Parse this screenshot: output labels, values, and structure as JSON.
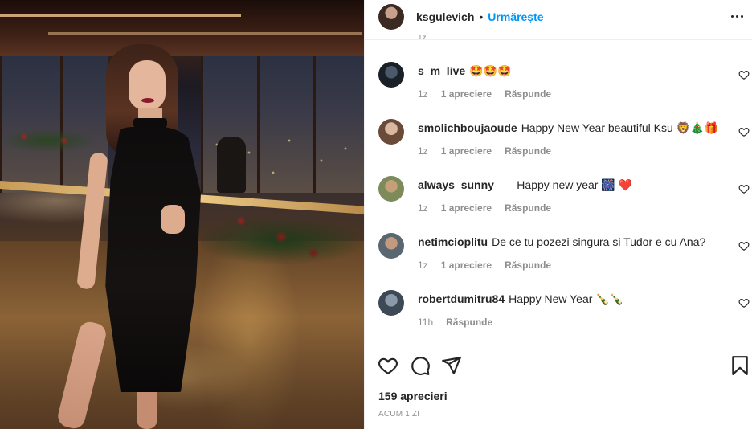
{
  "post": {
    "author": "ksgulevich",
    "dot": "•",
    "follow_label": "Urmărește",
    "more_icon": "more-horizontal-icon",
    "scroll_stub": "1z"
  },
  "comments": [
    {
      "user": "s_m_live",
      "text": "🤩🤩🤩",
      "age": "1z",
      "likes": "1 apreciere",
      "reply": "Răspunde"
    },
    {
      "user": "smolichboujaoude",
      "text": "Happy New Year beautiful Ksu 🦁🎄🎁",
      "age": "1z",
      "likes": "1 apreciere",
      "reply": "Răspunde"
    },
    {
      "user": "always_sunny___",
      "text": "Happy new year 🎆 ❤️",
      "age": "1z",
      "likes": "1 apreciere",
      "reply": "Răspunde"
    },
    {
      "user": "netimcioplitu",
      "text": "De ce tu pozezi singura si Tudor e cu Ana?",
      "age": "1z",
      "likes": "1 apreciere",
      "reply": "Răspunde"
    },
    {
      "user": "robertdumitru84",
      "text": "Happy New Year 🍾🍾",
      "age": "11h",
      "likes": "",
      "reply": "Răspunde"
    }
  ],
  "actions": {
    "like_icon": "heart-icon",
    "comment_icon": "comment-icon",
    "share_icon": "send-icon",
    "save_icon": "bookmark-icon"
  },
  "likes_count": "159 aprecieri",
  "posted_time": "ACUM 1 ZI",
  "colors": {
    "accent": "#0095f6",
    "text": "#262626",
    "muted": "#8e8e8e",
    "divider": "#efefef"
  }
}
